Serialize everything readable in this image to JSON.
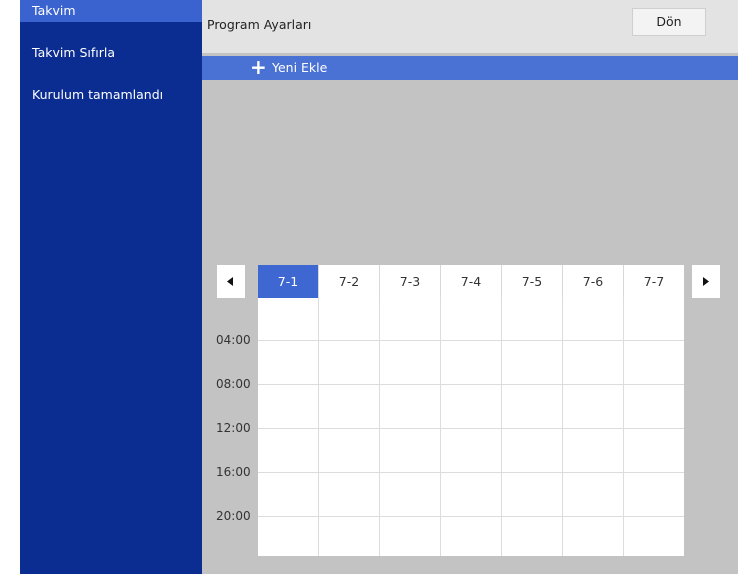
{
  "sidebar": {
    "items": [
      {
        "label": "Takvim",
        "active": true
      },
      {
        "label": "Takvim Sıfırla",
        "active": false
      },
      {
        "label": "Kurulum tamamlandı",
        "active": false
      }
    ]
  },
  "header": {
    "title": "Program Ayarları",
    "back_label": "Dön"
  },
  "add_row": {
    "label": "Yeni Ekle"
  },
  "calendar": {
    "days": [
      "7-1",
      "7-2",
      "7-3",
      "7-4",
      "7-5",
      "7-6",
      "7-7"
    ],
    "active_day": "7-1",
    "times": [
      "04:00",
      "08:00",
      "12:00",
      "16:00",
      "20:00"
    ]
  },
  "icons": {
    "prev": "triangle-left-icon",
    "next": "triangle-right-icon",
    "add": "plus-icon"
  },
  "colors": {
    "sidebar_bg": "#0b2d91",
    "sidebar_active": "#3b63d0",
    "add_row_bg": "#4a72d4",
    "day_active": "#3f67d2"
  }
}
